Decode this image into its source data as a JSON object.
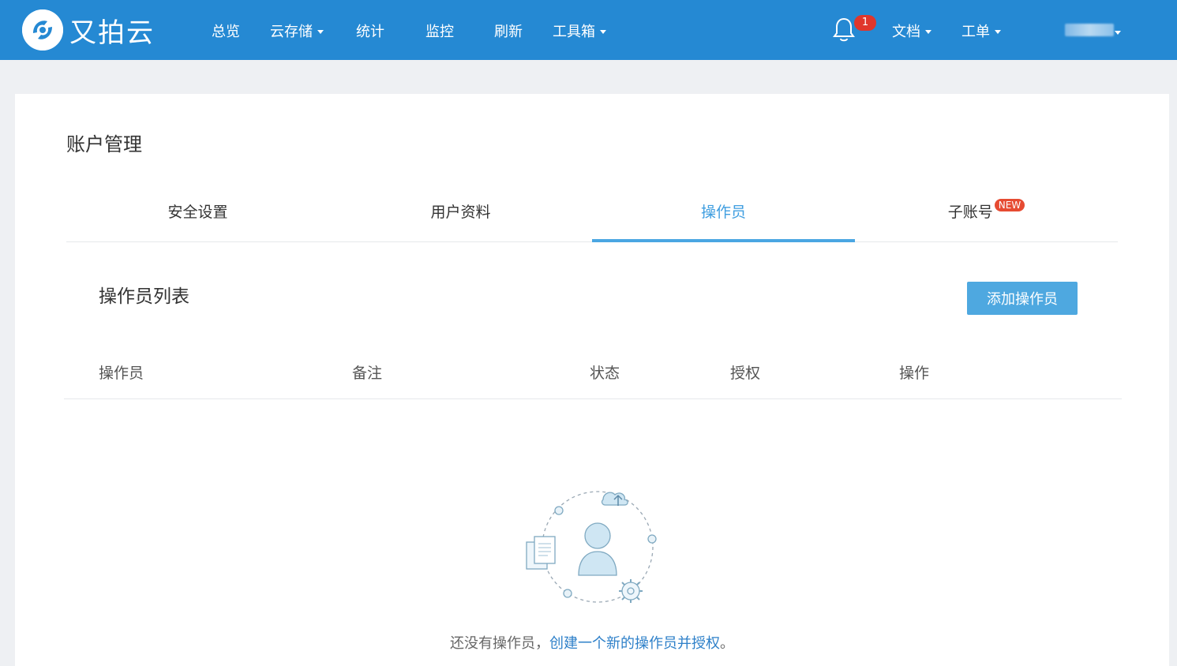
{
  "nav": {
    "logo_text": "又拍云",
    "items": [
      {
        "label": "总览",
        "caret": false
      },
      {
        "label": "云存储",
        "caret": true
      },
      {
        "label": "统计",
        "caret": false
      },
      {
        "label": "监控",
        "caret": false
      },
      {
        "label": "刷新",
        "caret": false
      },
      {
        "label": "工具箱",
        "caret": true
      }
    ],
    "notification_count": "1",
    "right_items": [
      {
        "label": "文档",
        "caret": true
      },
      {
        "label": "工单",
        "caret": true
      }
    ]
  },
  "page": {
    "title": "账户管理",
    "tabs": [
      {
        "label": "安全设置",
        "active": false
      },
      {
        "label": "用户资料",
        "active": false
      },
      {
        "label": "操作员",
        "active": true
      },
      {
        "label": "子账号",
        "active": false,
        "badge": "NEW"
      }
    ]
  },
  "operators": {
    "title": "操作员列表",
    "add_button": "添加操作员",
    "columns": [
      "操作员",
      "备注",
      "状态",
      "授权",
      "操作"
    ],
    "empty_text": "还没有操作员，",
    "empty_link": "创建一个新的操作员并授权",
    "empty_end": "。"
  },
  "colors": {
    "navbar": "#2589d3",
    "accent": "#4ea8e0",
    "badge": "#e0362c"
  }
}
